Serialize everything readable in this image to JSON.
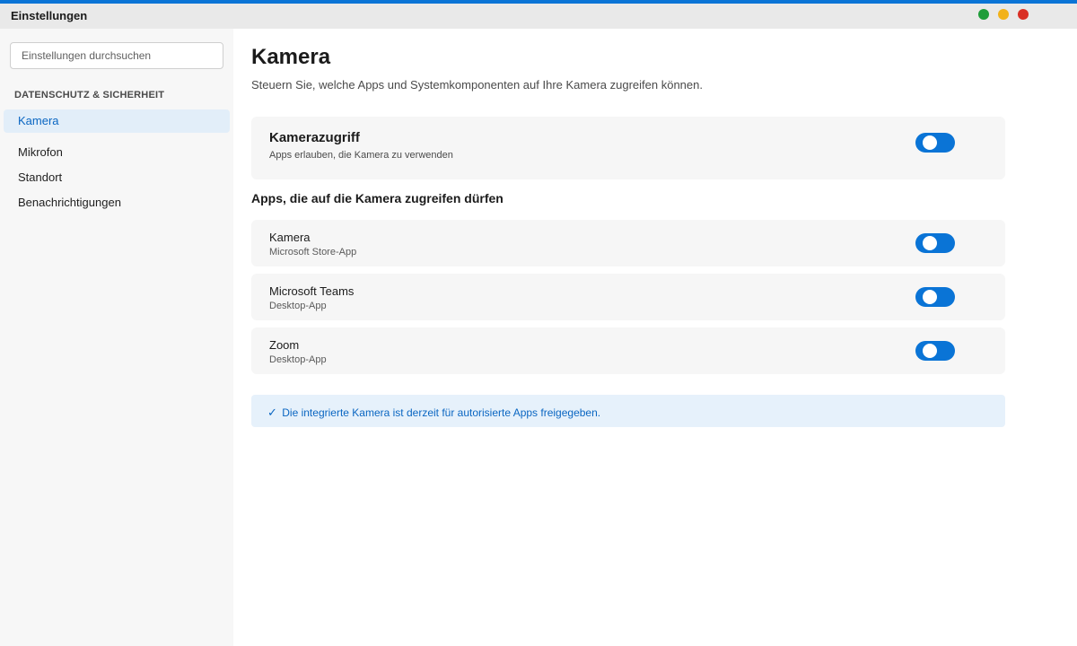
{
  "window": {
    "title": "Einstellungen",
    "controls": [
      {
        "name": "maximize",
        "color": "#1f9d3a"
      },
      {
        "name": "minimize",
        "color": "#f2b21a"
      },
      {
        "name": "close",
        "color": "#d93025"
      }
    ],
    "accent_color": "#0a74d6"
  },
  "sidebar": {
    "search_placeholder": "Einstellungen durchsuchen",
    "search_value": "",
    "section_label": "DATENSCHUTZ & SICHERHEIT",
    "items": [
      {
        "label": "Kamera",
        "active": true
      },
      {
        "label": "Mikrofon",
        "active": false
      },
      {
        "label": "Standort",
        "active": false
      },
      {
        "label": "Benachrichtigungen",
        "active": false
      }
    ]
  },
  "main": {
    "title": "Kamera",
    "subtitle": "Steuern Sie, welche Apps und Systemkomponenten auf Ihre Kamera zugreifen können.",
    "camera_access": {
      "title": "Kamerazugriff",
      "description": "Apps erlauben, die Kamera zu verwenden",
      "enabled": true
    },
    "apps_heading": "Apps, die auf die Kamera zugreifen dürfen",
    "apps": [
      {
        "name": "Kamera",
        "type": "Microsoft Store-App",
        "enabled": true
      },
      {
        "name": "Microsoft Teams",
        "type": "Desktop-App",
        "enabled": true
      },
      {
        "name": "Zoom",
        "type": "Desktop-App",
        "enabled": true
      }
    ],
    "info_banner": {
      "icon": "check-icon",
      "check_glyph": "✓",
      "text": "Die integrierte Kamera ist derzeit für autorisierte Apps freigegeben."
    }
  }
}
